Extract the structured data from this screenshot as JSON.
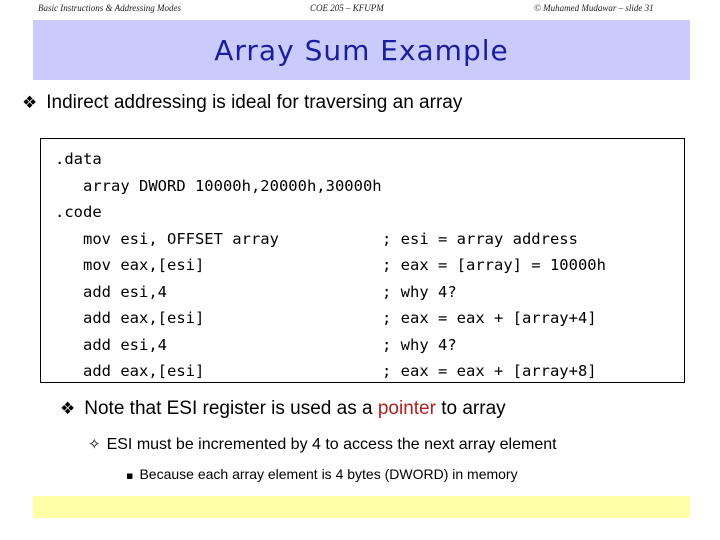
{
  "slide": {
    "title": "Array Sum Example",
    "title_color": "#1c1c9c",
    "banner_color": "#c9cbfb",
    "accent_color": "#b02020",
    "footer_band_color": "#ffffa8"
  },
  "bullets": {
    "intro": {
      "glyph": "❖",
      "text": "Indirect addressing is ideal for traversing an array"
    },
    "note": {
      "glyph": "❖",
      "text_before": "Note that ESI register is used as a ",
      "highlight": "pointer",
      "text_after": " to array"
    },
    "esi": {
      "glyph": "✧",
      "text": "ESI must be incremented by 4 to access the next array element"
    },
    "because": {
      "glyph": "▪",
      "text": "Because each array element is 4 bytes (DWORD) in memory"
    }
  },
  "code": {
    "lines": [
      {
        "source": ".data",
        "comment": ""
      },
      {
        "source": "   array DWORD 10000h,20000h,30000h",
        "comment": ""
      },
      {
        "source": ".code",
        "comment": ""
      },
      {
        "source": "   mov esi, OFFSET array",
        "comment": "; esi = array address"
      },
      {
        "source": "   mov eax,[esi]",
        "comment": "; eax = [array] = 10000h"
      },
      {
        "source": "   add esi,4",
        "comment": "; why 4?"
      },
      {
        "source": "   add eax,[esi]",
        "comment": "; eax = eax + [array+4]"
      },
      {
        "source": "   add esi,4",
        "comment": "; why 4?"
      },
      {
        "source": "   add eax,[esi]",
        "comment": "; eax = eax + [array+8]"
      }
    ]
  },
  "footer": {
    "left": "Basic Instructions & Addressing Modes",
    "center": "COE 205 – KFUPM",
    "right": "© Muhamed Mudawar – slide 31"
  }
}
